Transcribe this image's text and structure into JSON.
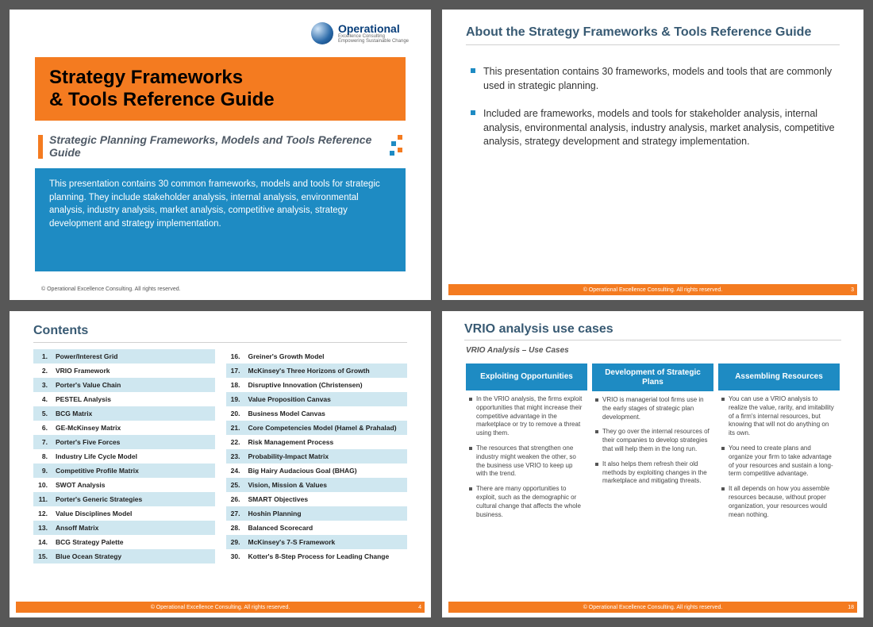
{
  "brand": {
    "name": "Operational",
    "tag": "Excellence Consulting",
    "sub2": "Empowering Sustainable Change"
  },
  "slide1": {
    "title": "Strategy Frameworks\n& Tools Reference Guide",
    "subtitle": "Strategic Planning Frameworks, Models and Tools Reference Guide",
    "blue": "This presentation contains 30 common frameworks, models and tools for strategic planning. They include stakeholder analysis, internal analysis, environmental analysis, industry analysis, market analysis, competitive analysis, strategy development and strategy implementation.",
    "foot": "© Operational Excellence Consulting.  All rights reserved."
  },
  "slide2": {
    "title": "About the Strategy Frameworks & Tools Reference Guide",
    "b1": "This presentation contains 30 frameworks, models and tools that are commonly used in strategic planning.",
    "b2": "Included are frameworks, models and tools for stakeholder analysis, internal analysis, environmental analysis, industry analysis, market analysis, competitive analysis, strategy development and strategy implementation.",
    "foot": "© Operational Excellence Consulting.  All rights reserved.",
    "pg": "3"
  },
  "slide3": {
    "title": "Contents",
    "items": [
      "Power/Interest Grid",
      "VRIO Framework",
      "Porter's Value Chain",
      "PESTEL Analysis",
      "BCG Matrix",
      "GE-McKinsey Matrix",
      "Porter's Five Forces",
      "Industry Life Cycle Model",
      "Competitive Profile Matrix",
      "SWOT Analysis",
      "Porter's Generic Strategies",
      "Value Disciplines Model",
      "Ansoff Matrix",
      "BCG Strategy Palette",
      "Blue Ocean Strategy",
      "Greiner's Growth Model",
      "McKinsey's Three Horizons of Growth",
      "Disruptive Innovation (Christensen)",
      "Value Proposition Canvas",
      "Business Model Canvas",
      "Core Competencies Model (Hamel & Prahalad)",
      "Risk Management Process",
      "Probability-Impact Matrix",
      "Big Hairy Audacious Goal (BHAG)",
      "Vision, Mission & Values",
      "SMART Objectives",
      "Hoshin Planning",
      "Balanced Scorecard",
      "McKinsey's 7-S Framework",
      "Kotter's 8-Step Process for Leading Change"
    ],
    "foot": "© Operational Excellence Consulting.  All rights reserved.",
    "pg": "4"
  },
  "slide4": {
    "title": "VRIO analysis use cases",
    "sub": "VRIO Analysis – Use Cases",
    "cols": [
      {
        "head": "Exploiting Opportunities",
        "pts": [
          "In the VRIO analysis, the firms exploit opportunities that might increase their competitive advantage in the marketplace or try to remove a threat using them.",
          "The resources that strengthen one industry might weaken the other, so the business use VRIO to keep up with the trend.",
          "There are many opportunities to exploit, such as the demographic or cultural change that affects the whole business."
        ]
      },
      {
        "head": "Development of Strategic Plans",
        "pts": [
          "VRIO is managerial tool firms use in the early stages of strategic plan development.",
          "They go over the internal resources of their companies to develop strategies that will help them in the long run.",
          "It also helps them refresh their old methods by exploiting changes in the marketplace and mitigating threats."
        ]
      },
      {
        "head": "Assembling Resources",
        "pts": [
          "You can use a VRIO analysis to realize the value, rarity, and imitability of a firm's internal resources, but knowing that will not do anything on its own.",
          "You need to create plans and organize your firm to take advantage of your resources and sustain a long-term competitive advantage.",
          "It all depends on how you assemble resources because, without proper organization, your resources would mean nothing."
        ]
      }
    ],
    "foot": "© Operational Excellence Consulting.  All rights reserved.",
    "pg": "18"
  }
}
